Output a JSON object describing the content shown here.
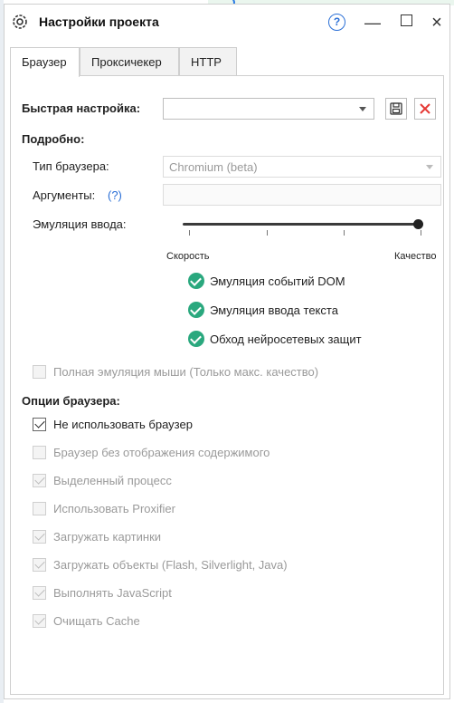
{
  "window": {
    "title": "Настройки проекта",
    "help_label": "?",
    "minimize_label": "—",
    "close_label": "×"
  },
  "tabs": [
    {
      "label": "Браузер",
      "active": true
    },
    {
      "label": "Проксичекер",
      "active": false
    },
    {
      "label": "HTTP",
      "active": false
    }
  ],
  "quick_setup": {
    "label": "Быстрая настройка:",
    "value": ""
  },
  "details": {
    "heading": "Подробно:",
    "browser_type_label": "Тип браузера:",
    "browser_type_value": "Chromium (beta)",
    "arguments_label": "Аргументы:",
    "arguments_help": "(?)",
    "arguments_value": "",
    "input_emulation_label": "Эмуляция ввода:",
    "slider_min_label": "Скорость",
    "slider_max_label": "Качество",
    "slider_value": 1.0,
    "features": [
      "Эмуляция событий DOM",
      "Эмуляция ввода текста",
      "Обход нейросетевых защит"
    ],
    "full_mouse_emulation": {
      "label": "Полная эмуляция мыши (Только макс. качество)",
      "checked": false,
      "enabled": false
    }
  },
  "browser_options": {
    "heading": "Опции браузера:",
    "items": [
      {
        "label": "Не использовать браузер",
        "checked": true,
        "enabled": true
      },
      {
        "label": "Браузер без отображения содержимого",
        "checked": false,
        "enabled": false
      },
      {
        "label": "Выделенный процесс",
        "checked": true,
        "enabled": false
      },
      {
        "label": "Использовать Proxifier",
        "checked": false,
        "enabled": false
      },
      {
        "label": "Загружать картинки",
        "checked": true,
        "enabled": false
      },
      {
        "label": "Загружать объекты (Flash, Silverlight, Java)",
        "checked": true,
        "enabled": false
      },
      {
        "label": "Выполнять JavaScript",
        "checked": true,
        "enabled": false
      },
      {
        "label": "Очищать Cache",
        "checked": true,
        "enabled": false
      }
    ]
  },
  "colors": {
    "accent": "#2a6fd6",
    "success": "#2aa87e",
    "danger": "#e53935"
  }
}
